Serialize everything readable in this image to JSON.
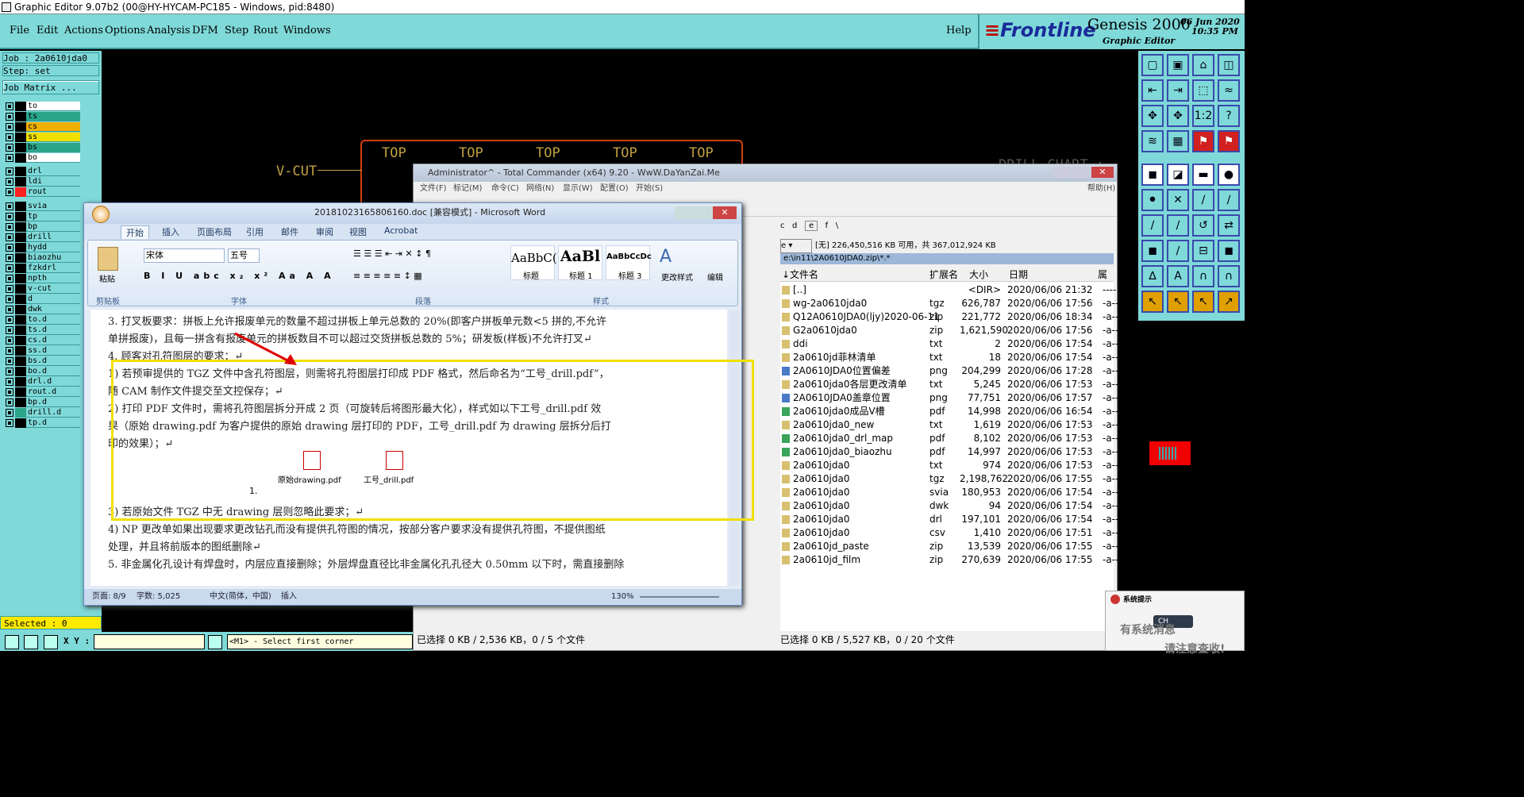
{
  "app": {
    "title": "Graphic Editor 9.07b2 (00@HY-HYCAM-PC185 - Windows, pid:8480)",
    "menu": [
      "File",
      "Edit",
      "Actions",
      "Options",
      "Analysis",
      "DFM",
      "Step",
      "Rout",
      "Windows"
    ],
    "help": "Help",
    "brand": {
      "logo": "Frontline",
      "product": "Genesis 2000",
      "subtitle": "Graphic Editor",
      "date": "06 Jun 2020",
      "time": "10:35 PM"
    }
  },
  "job": {
    "job": "Job : 2a0610jda0",
    "step": "Step: set",
    "matrix_button": "Job Matrix ..."
  },
  "layers": [
    {
      "name": "to",
      "color": "#ffffff"
    },
    {
      "name": "ts",
      "color": "#2aa58a"
    },
    {
      "name": "cs",
      "color": "#f0b000"
    },
    {
      "name": "ss",
      "color": "#f0e000"
    },
    {
      "name": "bs",
      "color": "#2aa58a"
    },
    {
      "name": "bo",
      "color": "#ffffff"
    },
    {
      "name": "drl",
      "color": "#7fd9d9"
    },
    {
      "name": "ldi",
      "color": "#7fd9d9"
    },
    {
      "name": "rout",
      "color": "#ff2020"
    },
    {
      "name": "svia",
      "color": "#7fd9d9"
    },
    {
      "name": "tp",
      "color": "#7fd9d9"
    },
    {
      "name": "bp",
      "color": "#7fd9d9"
    },
    {
      "name": "drill",
      "color": "#7fd9d9"
    },
    {
      "name": "hydd",
      "color": "#7fd9d9"
    },
    {
      "name": "biaozhu",
      "color": "#7fd9d9"
    },
    {
      "name": "fzkdrl",
      "color": "#7fd9d9"
    },
    {
      "name": "npth",
      "color": "#7fd9d9"
    },
    {
      "name": "v-cut",
      "color": "#7fd9d9"
    },
    {
      "name": "d",
      "color": "#7fd9d9"
    },
    {
      "name": "dwk",
      "color": "#7fd9d9"
    },
    {
      "name": "to.d",
      "color": "#7fd9d9"
    },
    {
      "name": "ts.d",
      "color": "#7fd9d9"
    },
    {
      "name": "cs.d",
      "color": "#7fd9d9"
    },
    {
      "name": "ss.d",
      "color": "#7fd9d9"
    },
    {
      "name": "bs.d",
      "color": "#7fd9d9"
    },
    {
      "name": "bo.d",
      "color": "#7fd9d9"
    },
    {
      "name": "drl.d",
      "color": "#7fd9d9"
    },
    {
      "name": "rout.d",
      "color": "#7fd9d9"
    },
    {
      "name": "bp.d",
      "color": "#7fd9d9"
    },
    {
      "name": "drill.d",
      "color": "#2aa58a"
    },
    {
      "name": "tp.d",
      "color": "#7fd9d9"
    }
  ],
  "selected": "Selected : 0",
  "coords": {
    "label": "X Y :",
    "prompt": "<M1> - Select first corner"
  },
  "cad": {
    "top_labels": [
      "TOP",
      "TOP",
      "TOP",
      "TOP",
      "TOP"
    ],
    "vcut": "V-CUT",
    "drill_chart": "DRILL CHART :"
  },
  "word": {
    "title": "20181023165806160.doc [兼容模式] - Microsoft Word",
    "tabs": [
      "开始",
      "插入",
      "页面布局",
      "引用",
      "邮件",
      "审阅",
      "视图",
      "Acrobat"
    ],
    "font": "宋体",
    "size": "五号",
    "styles": [
      "AaBbC(",
      "AaBl",
      "AaBbCcDc"
    ],
    "style_names": [
      "标题",
      "标题 1",
      "标题 3"
    ],
    "groups": [
      "剪贴板",
      "字体",
      "段落",
      "样式"
    ],
    "change_style": "更改样式",
    "edit": "编辑",
    "paste": "粘贴",
    "lines": [
      "3.   打叉板要求：拼板上允许报废单元的数量不超过拼板上单元总数的 20%(即客户拼板单元数<5 拼的,不允许",
      "      单拼报废)，且每一拼含有报废单元的拼板数目不可以超过交货拼板总数的 5%；研发板(样板)不允许打叉↵",
      "4.   顾客对孔符图层的要求：↵",
      "   1) 若预审提供的 TGZ 文件中含孔符图层，则需将孔符图层打印成 PDF 格式，然后命名为“工号_drill.pdf”，",
      "      随 CAM 制作文件提交至文控保存；↵",
      "   2) 打印 PDF 文件时，需将孔符图层拆分开成 2 页（可旋转后将图形最大化），样式如以下工号_drill.pdf 效",
      "      果（原始 drawing.pdf 为客户提供的原始 drawing 层打印的 PDF，工号_drill.pdf 为 drawing 层拆分后打",
      "      印的效果）；↵",
      "   3) 若原始文件 TGZ 中无 drawing 层则忽略此要求；↵",
      "   4) NP 更改单如果出现要求更改钻孔而没有提供孔符图的情况，按部分客户要求没有提供孔符图，不提供图纸",
      "      处理，并且将前版本的图纸删除↵",
      "5.   非金属化孔设计有焊盘时，内层应直接删除；外层焊盘直径比非金属化孔孔径大 0.50mm 以下时，需直接删除"
    ],
    "attachments": [
      "原始drawing.pdf",
      "工号_drill.pdf"
    ],
    "list_num": "1.",
    "status": {
      "page": "页面: 8/9",
      "words": "字数: 5,025",
      "lang": "中文(简体，中国)",
      "mode": "插入",
      "zoom": "130%"
    }
  },
  "tc": {
    "title": "Administrator^ - Total Commander (x64) 9.20 - WwW.DaYanZai.Me",
    "menu": [
      "文件(F)",
      "标记(M)",
      "命令(C)",
      "网络(N)",
      "显示(W)",
      "配置(O)",
      "开始(S)"
    ],
    "help": "帮助(H)",
    "drive_info": "[无] 226,450,516 KB 可用，共 367,012,924 KB",
    "path": "e:\\in11\\2A0610JDA0.zip\\*.*",
    "columns": [
      "↓文件名",
      "扩展名",
      "大小",
      "日期",
      "属性"
    ],
    "files": [
      {
        "name": "[..]",
        "ext": "",
        "size": "<DIR>",
        "date": "2020/06/06 21:32",
        "attr": "----"
      },
      {
        "name": "wg-2a0610jda0",
        "ext": "tgz",
        "size": "626,787",
        "date": "2020/06/06 17:56",
        "attr": "-a--"
      },
      {
        "name": "Q12A0610JDA0(ljy)2020-06-11",
        "ext": "zip",
        "size": "221,772",
        "date": "2020/06/06 18:34",
        "attr": "-a--"
      },
      {
        "name": "G2a0610jda0",
        "ext": "zip",
        "size": "1,621,590",
        "date": "2020/06/06 17:56",
        "attr": "-a--"
      },
      {
        "name": "ddi",
        "ext": "txt",
        "size": "2",
        "date": "2020/06/06 17:54",
        "attr": "-a--"
      },
      {
        "name": "2a0610jd菲林清单",
        "ext": "txt",
        "size": "18",
        "date": "2020/06/06 17:54",
        "attr": "-a--"
      },
      {
        "name": "2A0610JDA0位置偏差",
        "ext": "png",
        "size": "204,299",
        "date": "2020/06/06 17:28",
        "attr": "-a--"
      },
      {
        "name": "2a0610jda0各层更改清单",
        "ext": "txt",
        "size": "5,245",
        "date": "2020/06/06 17:53",
        "attr": "-a--"
      },
      {
        "name": "2A0610JDA0盖章位置",
        "ext": "png",
        "size": "77,751",
        "date": "2020/06/06 17:57",
        "attr": "-a--"
      },
      {
        "name": "2a0610jda0成品V槽",
        "ext": "pdf",
        "size": "14,998",
        "date": "2020/06/06 16:54",
        "attr": "-a--"
      },
      {
        "name": "2a0610jda0_new",
        "ext": "txt",
        "size": "1,619",
        "date": "2020/06/06 17:53",
        "attr": "-a--"
      },
      {
        "name": "2a0610jda0_drl_map",
        "ext": "pdf",
        "size": "8,102",
        "date": "2020/06/06 17:53",
        "attr": "-a--"
      },
      {
        "name": "2a0610jda0_biaozhu",
        "ext": "pdf",
        "size": "14,997",
        "date": "2020/06/06 17:53",
        "attr": "-a--"
      },
      {
        "name": "2a0610jda0",
        "ext": "txt",
        "size": "974",
        "date": "2020/06/06 17:53",
        "attr": "-a--"
      },
      {
        "name": "2a0610jda0",
        "ext": "tgz",
        "size": "2,198,762",
        "date": "2020/06/06 17:55",
        "attr": "-a--"
      },
      {
        "name": "2a0610jda0",
        "ext": "svia",
        "size": "180,953",
        "date": "2020/06/06 17:54",
        "attr": "-a--"
      },
      {
        "name": "2a0610jda0",
        "ext": "dwk",
        "size": "94",
        "date": "2020/06/06 17:54",
        "attr": "-a--"
      },
      {
        "name": "2a0610jda0",
        "ext": "drl",
        "size": "197,101",
        "date": "2020/06/06 17:54",
        "attr": "-a--"
      },
      {
        "name": "2a0610jda0",
        "ext": "csv",
        "size": "1,410",
        "date": "2020/06/06 17:51",
        "attr": "-a--"
      },
      {
        "name": "2a0610jd_paste",
        "ext": "zip",
        "size": "13,539",
        "date": "2020/06/06 17:55",
        "attr": "-a--"
      },
      {
        "name": "2a0610jd_film",
        "ext": "zip",
        "size": "270,639",
        "date": "2020/06/06 17:55",
        "attr": "-a--"
      }
    ],
    "left_status": "已选择 0 KB / 2,536 KB，0 / 5 个文件",
    "right_status": "已选择 0 KB / 5,527 KB，0 / 20 个文件",
    "drives": [
      "c",
      "d",
      "e",
      "f",
      "\\"
    ]
  },
  "notice": {
    "title": "系统提示",
    "ime": "CH",
    "body": "有系统消息",
    "body2": "请注意查收!"
  }
}
